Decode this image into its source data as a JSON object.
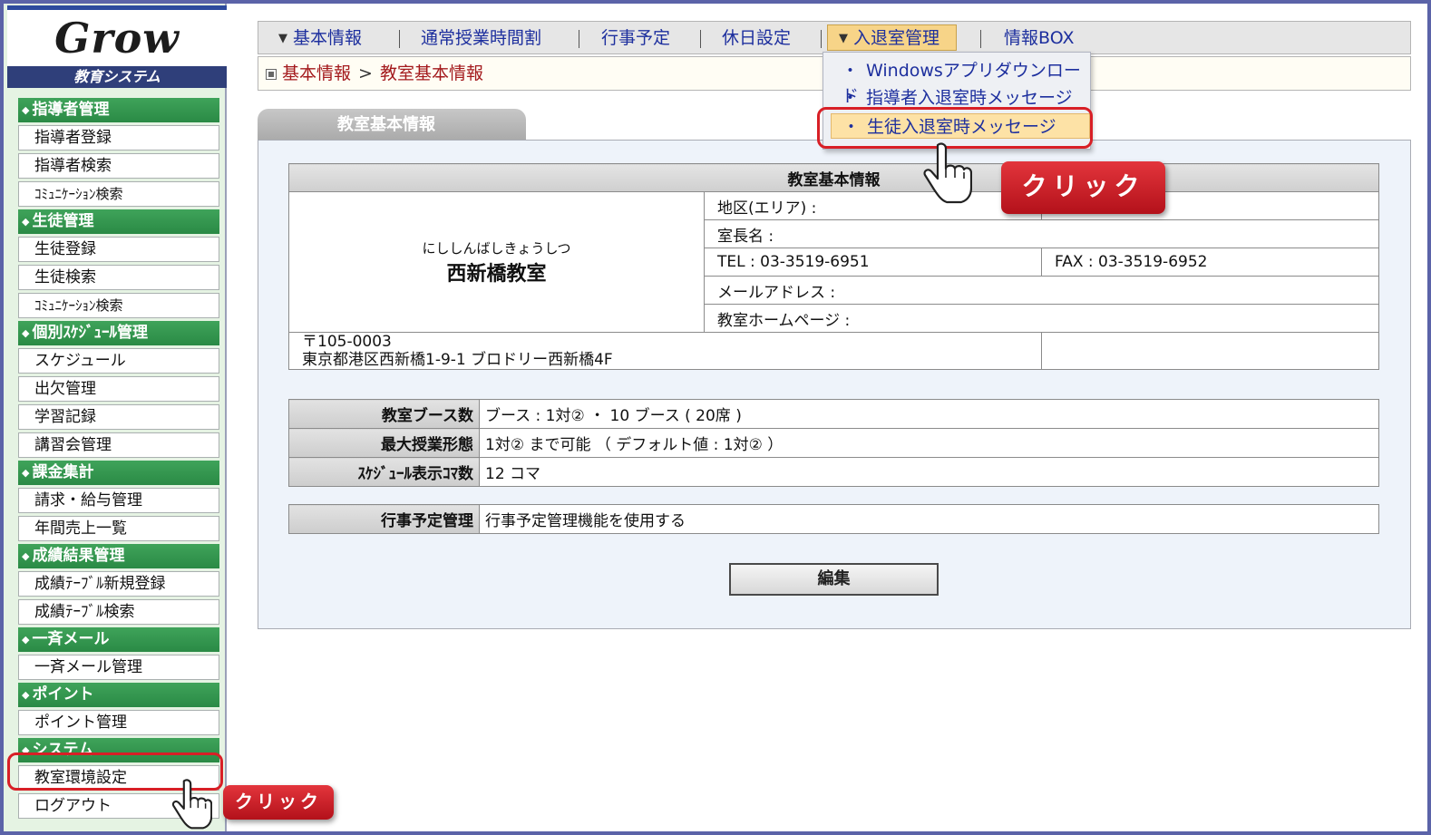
{
  "logo": {
    "brand": "Grow",
    "subtitle": "教育システム"
  },
  "sidebar": {
    "sections": [
      {
        "title": "指導者管理",
        "items": [
          "指導者登録",
          "指導者検索",
          "ｺﾐｭﾆｹｰｼｮﾝ検索"
        ]
      },
      {
        "title": "生徒管理",
        "items": [
          "生徒登録",
          "生徒検索",
          "ｺﾐｭﾆｹｰｼｮﾝ検索"
        ]
      },
      {
        "title": "個別ｽｹｼﾞｭｰﾙ管理",
        "items": [
          "スケジュール",
          "出欠管理",
          "学習記録",
          "講習会管理"
        ]
      },
      {
        "title": "課金集計",
        "items": [
          "請求・給与管理",
          "年間売上一覧"
        ]
      },
      {
        "title": "成績結果管理",
        "items": [
          "成績ﾃｰﾌﾞﾙ新規登録",
          "成績ﾃｰﾌﾞﾙ検索"
        ]
      },
      {
        "title": "一斉メール",
        "items": [
          "一斉メール管理"
        ]
      },
      {
        "title": "ポイント",
        "items": [
          "ポイント管理"
        ]
      },
      {
        "title": "システム",
        "items": [
          "教室環境設定",
          "ログアウト"
        ]
      }
    ]
  },
  "topnav": {
    "tabs": [
      {
        "label": "基本情報",
        "has_chevron": true,
        "active": false
      },
      {
        "label": "通常授業時間割",
        "has_chevron": false,
        "active": false
      },
      {
        "label": "行事予定",
        "has_chevron": false,
        "active": false
      },
      {
        "label": "休日設定",
        "has_chevron": false,
        "active": false
      },
      {
        "label": "入退室管理",
        "has_chevron": true,
        "active": true
      },
      {
        "label": "情報BOX",
        "has_chevron": false,
        "active": false
      }
    ]
  },
  "dropdown": {
    "items": [
      "Windowsアプリダウンロード",
      "指導者入退室時メッセージ",
      "生徒入退室時メッセージ"
    ],
    "highlighted_index": 2
  },
  "breadcrumb": {
    "parent": "基本情報",
    "separator": ">",
    "current": "教室基本情報"
  },
  "panel": {
    "tab_label": "教室基本情報"
  },
  "info": {
    "header": "教室基本情報",
    "school_kana": "にししんばしきょうしつ",
    "school_name": "西新橋教室",
    "area_label": "地区(エリア) :",
    "head_label": "室長名 :",
    "tel": "TEL : 03-3519-6951",
    "fax": "FAX : 03-3519-6952",
    "email_label": "メールアドレス :",
    "homepage_label": "教室ホームページ :",
    "postal": "〒105-0003",
    "address": "東京都港区西新橋1-9-1 ブロドリー西新橋4F"
  },
  "settings": [
    {
      "label": "教室ブース数",
      "value": "ブース : 1対② ・ 10 ブース ( 20席 )"
    },
    {
      "label": "最大授業形態",
      "value": "1対② まで可能 （ デフォルト値 : 1対② ）"
    },
    {
      "label": "ｽｹｼﾞｭｰﾙ表示ｺﾏ数",
      "value": "12 コマ"
    }
  ],
  "event": {
    "label": "行事予定管理",
    "value": "行事予定管理機能を使用する"
  },
  "buttons": {
    "edit": "編集"
  },
  "annotations": {
    "click_label": "クリック"
  },
  "colors": {
    "section_green": "#2a8a45",
    "nav_text": "#1d2f9e",
    "breadcrumb_red": "#a3191c",
    "annotation_red": "#d81f26",
    "active_tab": "#f7d488"
  }
}
